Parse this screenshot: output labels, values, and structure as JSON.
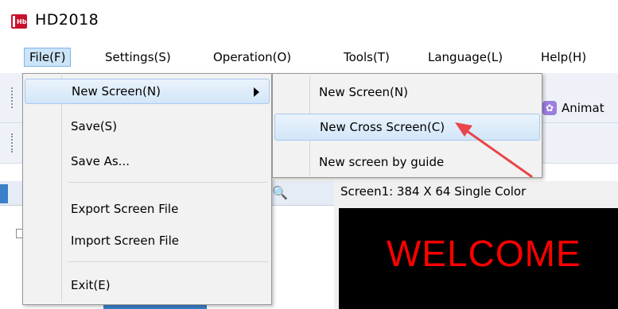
{
  "window": {
    "title": "HD2018",
    "icon": "hd-logo-icon"
  },
  "menubar": {
    "items": [
      {
        "label": "File(F)",
        "active": true
      },
      {
        "label": "Settings(S)"
      },
      {
        "label": "Operation(O)"
      },
      {
        "label": "Tools(T)"
      },
      {
        "label": "Language(L)"
      },
      {
        "label": "Help(H)"
      }
    ]
  },
  "toolbar": {
    "animation_label": "Animat"
  },
  "file_menu": {
    "items": [
      {
        "label": "New Screen(N)",
        "has_submenu": true,
        "hovered": true
      },
      {
        "label": "Save(S)"
      },
      {
        "label": "Save As..."
      },
      {
        "label": "Export Screen File"
      },
      {
        "label": "Import Screen File"
      },
      {
        "label": "Exit(E)"
      }
    ]
  },
  "new_screen_submenu": {
    "items": [
      {
        "label": "New Screen(N)"
      },
      {
        "label": "New Cross Screen(C)",
        "hovered": true
      },
      {
        "label": "New screen by guide"
      }
    ]
  },
  "screen_preview": {
    "info": "Screen1: 384 X 64  Single Color",
    "text": "WELCOME"
  },
  "colors": {
    "accent": "#cce4f7",
    "preview_background": "#000000",
    "preview_text": "#ff0000",
    "annotation_arrow": "#e8464b"
  }
}
